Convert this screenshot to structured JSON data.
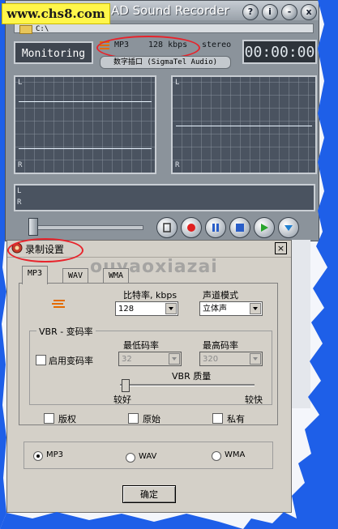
{
  "watermark_site": "www.chs8.com",
  "watermark_brand": "ouyaoxiazai",
  "recorder": {
    "title_partial": "AD Sound Recorder",
    "title_buttons": [
      "?",
      "i",
      "-",
      "x"
    ],
    "path": "C:\\",
    "monitoring_label": "Monitoring",
    "format": "MP3",
    "bitrate": "128 kbps",
    "channels": "stereo",
    "device": "数字插口 (SigmaTel Audio)",
    "timer": "00:00:00",
    "meter_labels": [
      "L",
      "R"
    ]
  },
  "dialog": {
    "title": "录制设置",
    "close_label": "×",
    "tabs": [
      "MP3",
      "WAV",
      "WMA"
    ],
    "bitrate_label": "比特率, kbps",
    "bitrate_value": "128",
    "channel_mode_label": "声道模式",
    "channel_mode_value": "立体声",
    "vbr_group_label": "VBR - 变码率",
    "enable_vbr_label": "启用变码率",
    "min_bitrate_label": "最低码率",
    "min_bitrate_value": "32",
    "max_bitrate_label": "最高码率",
    "max_bitrate_value": "320",
    "vbr_quality_label": "VBR 质量",
    "quality_left": "较好",
    "quality_right": "较快",
    "copyright_label": "版权",
    "original_label": "原始",
    "private_label": "私有",
    "output_formats": [
      "MP3",
      "WAV",
      "WMA"
    ],
    "selected_output": "MP3",
    "ok_label": "确定"
  },
  "colors": {
    "highlight_ring": "#e8232b",
    "border_blue": "#1e5fe8",
    "panel_gray": "#8b939b",
    "dialog_face": "#d4d0c8"
  }
}
